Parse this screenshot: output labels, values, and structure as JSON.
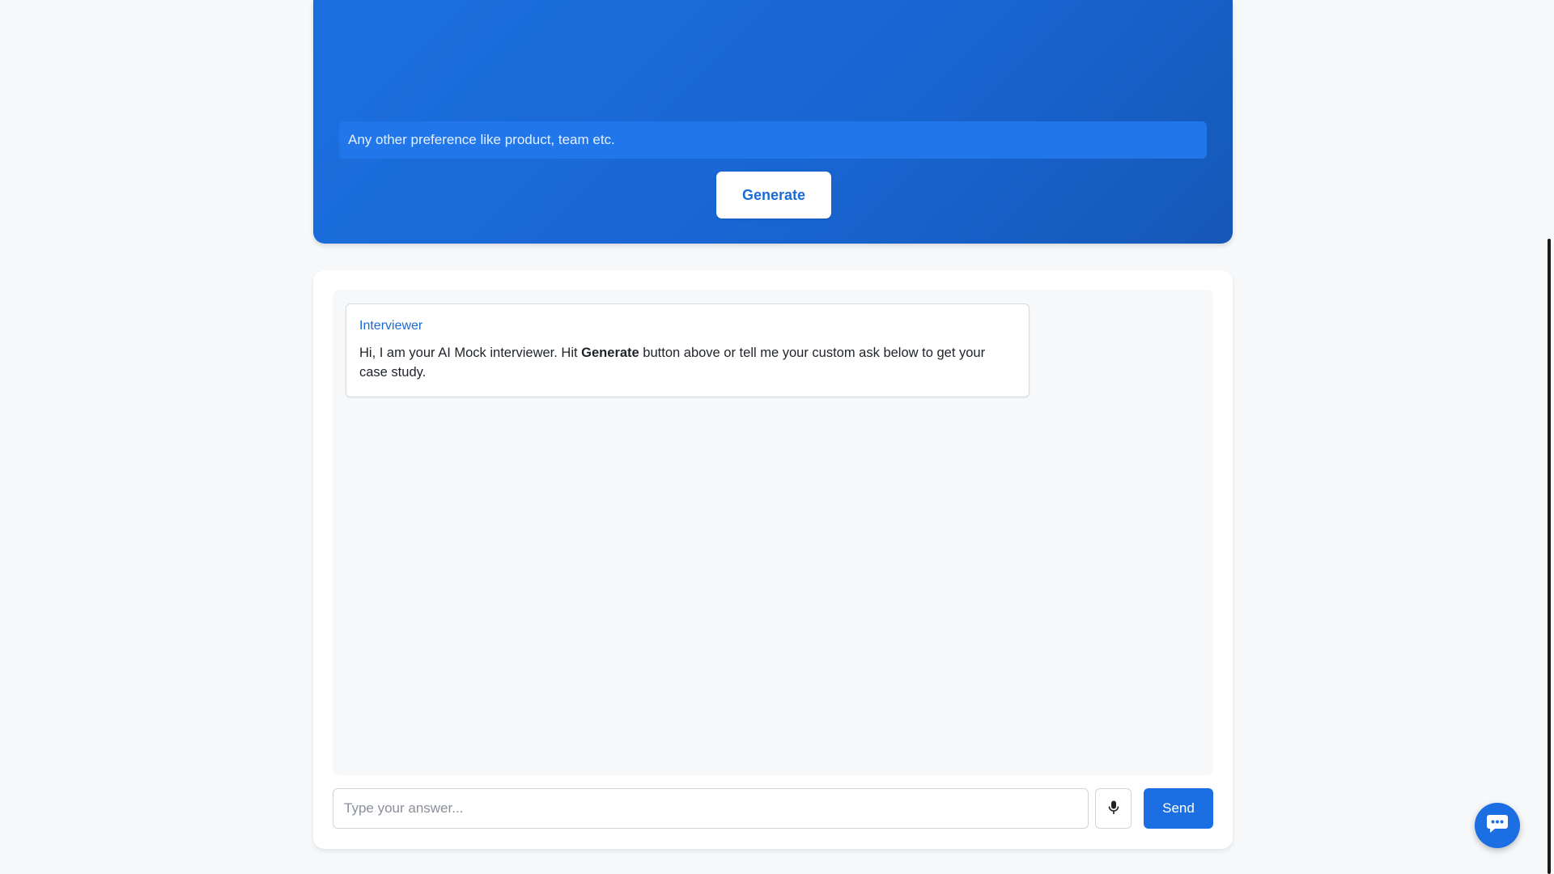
{
  "generator": {
    "preference_placeholder": "Any other preference like product, team etc.",
    "generate_label": "Generate"
  },
  "chat": {
    "messages": [
      {
        "sender": "Interviewer",
        "text_before": "Hi, I am your AI Mock interviewer. Hit ",
        "text_bold": "Generate",
        "text_after": " button above or tell me your custom ask below to get your case study."
      }
    ],
    "answer_placeholder": "Type your answer...",
    "send_label": "Send",
    "mic_icon": "microphone-icon"
  },
  "floating_button": {
    "icon": "chat-bubble-icon"
  },
  "colors": {
    "brand_blue": "#1b6fe3",
    "page_bg": "#f6f8fa"
  }
}
